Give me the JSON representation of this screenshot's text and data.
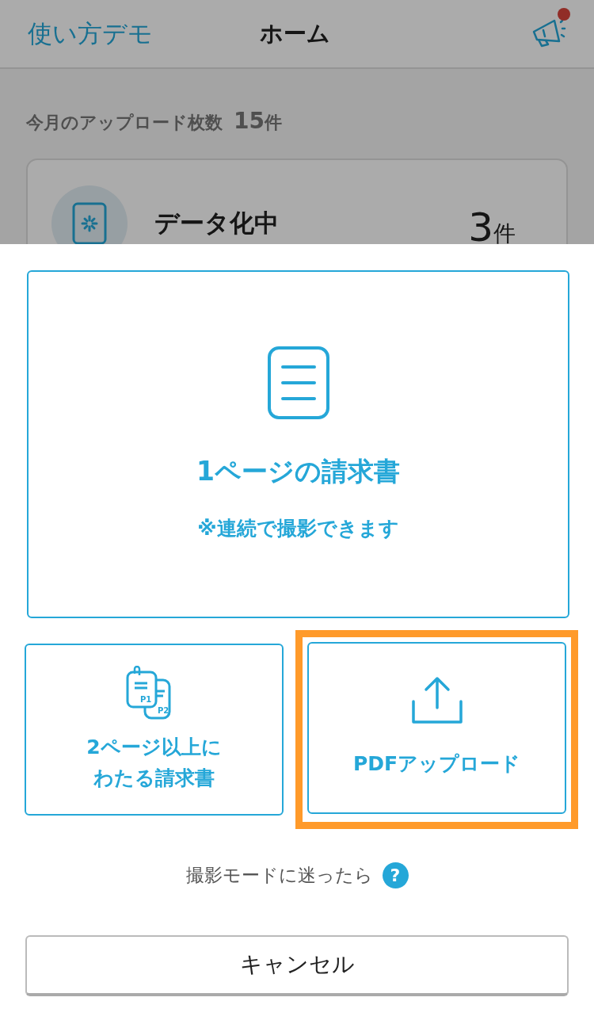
{
  "header": {
    "left_link": "使い方デモ",
    "title": "ホーム",
    "notification_dot": true
  },
  "background": {
    "monthly_label": "今月のアップロード枚数",
    "monthly_count": "15",
    "monthly_unit": "件",
    "status_card": {
      "label": "データ化中",
      "count": "3",
      "unit": "件"
    }
  },
  "sheet": {
    "options": [
      {
        "kind": "single",
        "title": "1ページの請求書",
        "note": "※連続で撮影できます",
        "highlighted": false
      },
      {
        "kind": "multi",
        "title_lines": [
          "2ページ以上に",
          "わたる請求書"
        ],
        "icon_labels": [
          "P1",
          "P2"
        ],
        "highlighted": false
      },
      {
        "kind": "upload",
        "title": "PDFアップロード",
        "highlighted": true
      }
    ],
    "help": {
      "text": "撮影モードに迷ったら",
      "icon": "?"
    },
    "cancel": "キャンセル"
  }
}
